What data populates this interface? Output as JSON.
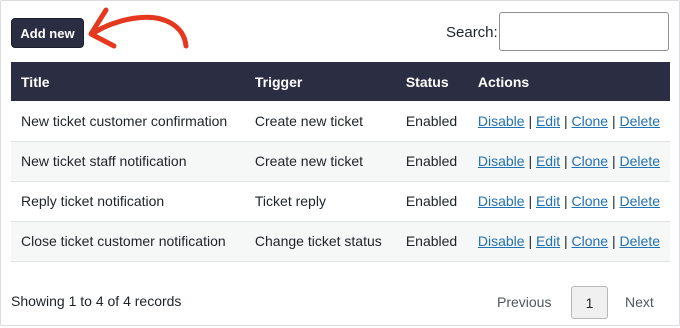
{
  "toolbar": {
    "add_new_label": "Add new",
    "search_label": "Search:",
    "search_value": ""
  },
  "table": {
    "headers": [
      "Title",
      "Trigger",
      "Status",
      "Actions"
    ],
    "rows": [
      {
        "title": "New ticket customer confirmation",
        "trigger": "Create new ticket",
        "status": "Enabled"
      },
      {
        "title": "New ticket staff notification",
        "trigger": "Create new ticket",
        "status": "Enabled"
      },
      {
        "title": "Reply ticket notification",
        "trigger": "Ticket reply",
        "status": "Enabled"
      },
      {
        "title": "Close ticket customer notification",
        "trigger": "Change ticket status",
        "status": "Enabled"
      }
    ],
    "actions": {
      "disable": "Disable",
      "edit": "Edit",
      "clone": "Clone",
      "delete": "Delete",
      "separator": "|"
    }
  },
  "footer": {
    "records_text": "Showing 1 to 4 of 4 records",
    "previous_label": "Previous",
    "current_page": "1",
    "next_label": "Next"
  },
  "colors": {
    "header_bg": "#2b2d42",
    "link": "#2271b1",
    "annotation_arrow": "#e5391f"
  }
}
